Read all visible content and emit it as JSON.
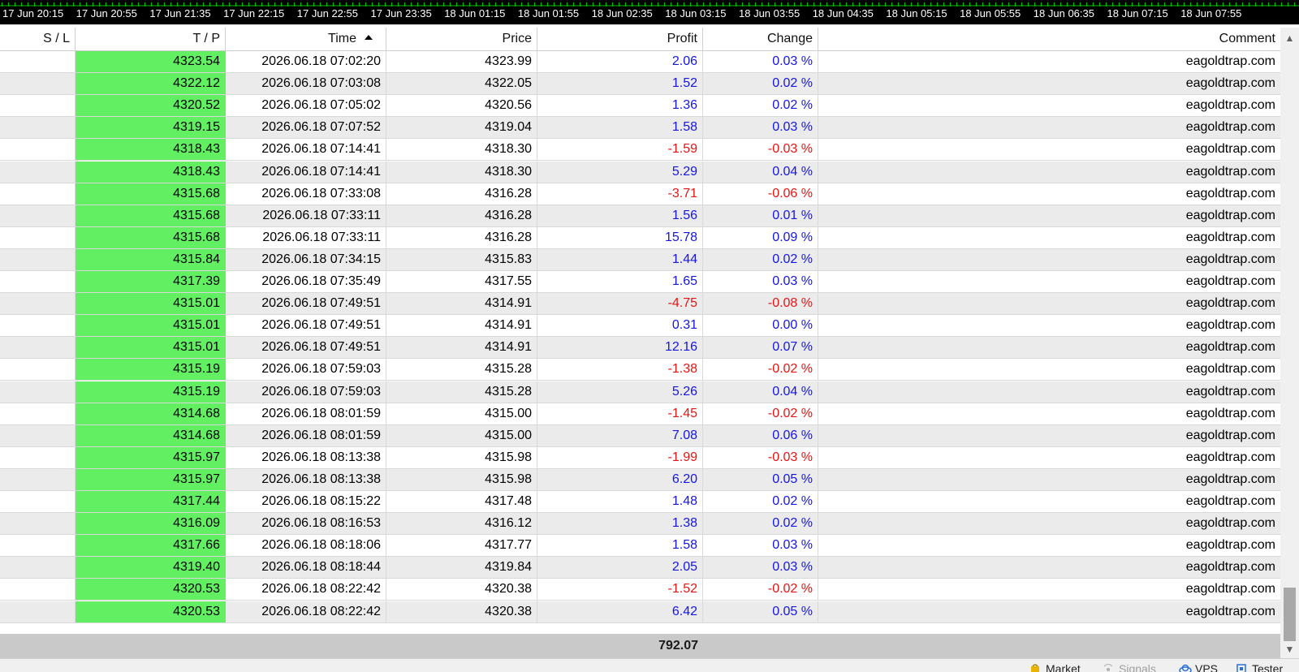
{
  "time_axis": {
    "labels": [
      "17 Jun 20:15",
      "17 Jun 20:55",
      "17 Jun 21:35",
      "17 Jun 22:15",
      "17 Jun 22:55",
      "17 Jun 23:35",
      "18 Jun 01:15",
      "18 Jun 01:55",
      "18 Jun 02:35",
      "18 Jun 03:15",
      "18 Jun 03:55",
      "18 Jun 04:35",
      "18 Jun 05:15",
      "18 Jun 05:55",
      "18 Jun 06:35",
      "18 Jun 07:15",
      "18 Jun 07:55"
    ],
    "tick_color": "#00c000"
  },
  "table": {
    "columns": [
      "S / L",
      "T / P",
      "Time",
      "Price",
      "Profit",
      "Change",
      "Comment"
    ],
    "sorted_column": "Time",
    "sort_direction": "ascending",
    "rows": [
      {
        "sl": "",
        "tp": "4323.54",
        "time": "2026.06.18 07:02:20",
        "price": "4323.99",
        "profit": "2.06",
        "change": "0.03 %",
        "comment": "eagoldtrap.com"
      },
      {
        "sl": "",
        "tp": "4322.12",
        "time": "2026.06.18 07:03:08",
        "price": "4322.05",
        "profit": "1.52",
        "change": "0.02 %",
        "comment": "eagoldtrap.com"
      },
      {
        "sl": "",
        "tp": "4320.52",
        "time": "2026.06.18 07:05:02",
        "price": "4320.56",
        "profit": "1.36",
        "change": "0.02 %",
        "comment": "eagoldtrap.com"
      },
      {
        "sl": "",
        "tp": "4319.15",
        "time": "2026.06.18 07:07:52",
        "price": "4319.04",
        "profit": "1.58",
        "change": "0.03 %",
        "comment": "eagoldtrap.com"
      },
      {
        "sl": "",
        "tp": "4318.43",
        "time": "2026.06.18 07:14:41",
        "price": "4318.30",
        "profit": "-1.59",
        "change": "-0.03 %",
        "comment": "eagoldtrap.com"
      },
      {
        "sl": "",
        "tp": "4318.43",
        "time": "2026.06.18 07:14:41",
        "price": "4318.30",
        "profit": "5.29",
        "change": "0.04 %",
        "comment": "eagoldtrap.com"
      },
      {
        "sl": "",
        "tp": "4315.68",
        "time": "2026.06.18 07:33:08",
        "price": "4316.28",
        "profit": "-3.71",
        "change": "-0.06 %",
        "comment": "eagoldtrap.com"
      },
      {
        "sl": "",
        "tp": "4315.68",
        "time": "2026.06.18 07:33:11",
        "price": "4316.28",
        "profit": "1.56",
        "change": "0.01 %",
        "comment": "eagoldtrap.com"
      },
      {
        "sl": "",
        "tp": "4315.68",
        "time": "2026.06.18 07:33:11",
        "price": "4316.28",
        "profit": "15.78",
        "change": "0.09 %",
        "comment": "eagoldtrap.com"
      },
      {
        "sl": "",
        "tp": "4315.84",
        "time": "2026.06.18 07:34:15",
        "price": "4315.83",
        "profit": "1.44",
        "change": "0.02 %",
        "comment": "eagoldtrap.com"
      },
      {
        "sl": "",
        "tp": "4317.39",
        "time": "2026.06.18 07:35:49",
        "price": "4317.55",
        "profit": "1.65",
        "change": "0.03 %",
        "comment": "eagoldtrap.com"
      },
      {
        "sl": "",
        "tp": "4315.01",
        "time": "2026.06.18 07:49:51",
        "price": "4314.91",
        "profit": "-4.75",
        "change": "-0.08 %",
        "comment": "eagoldtrap.com"
      },
      {
        "sl": "",
        "tp": "4315.01",
        "time": "2026.06.18 07:49:51",
        "price": "4314.91",
        "profit": "0.31",
        "change": "0.00 %",
        "comment": "eagoldtrap.com"
      },
      {
        "sl": "",
        "tp": "4315.01",
        "time": "2026.06.18 07:49:51",
        "price": "4314.91",
        "profit": "12.16",
        "change": "0.07 %",
        "comment": "eagoldtrap.com"
      },
      {
        "sl": "",
        "tp": "4315.19",
        "time": "2026.06.18 07:59:03",
        "price": "4315.28",
        "profit": "-1.38",
        "change": "-0.02 %",
        "comment": "eagoldtrap.com"
      },
      {
        "sl": "",
        "tp": "4315.19",
        "time": "2026.06.18 07:59:03",
        "price": "4315.28",
        "profit": "5.26",
        "change": "0.04 %",
        "comment": "eagoldtrap.com"
      },
      {
        "sl": "",
        "tp": "4314.68",
        "time": "2026.06.18 08:01:59",
        "price": "4315.00",
        "profit": "-1.45",
        "change": "-0.02 %",
        "comment": "eagoldtrap.com"
      },
      {
        "sl": "",
        "tp": "4314.68",
        "time": "2026.06.18 08:01:59",
        "price": "4315.00",
        "profit": "7.08",
        "change": "0.06 %",
        "comment": "eagoldtrap.com"
      },
      {
        "sl": "",
        "tp": "4315.97",
        "time": "2026.06.18 08:13:38",
        "price": "4315.98",
        "profit": "-1.99",
        "change": "-0.03 %",
        "comment": "eagoldtrap.com"
      },
      {
        "sl": "",
        "tp": "4315.97",
        "time": "2026.06.18 08:13:38",
        "price": "4315.98",
        "profit": "6.20",
        "change": "0.05 %",
        "comment": "eagoldtrap.com"
      },
      {
        "sl": "",
        "tp": "4317.44",
        "time": "2026.06.18 08:15:22",
        "price": "4317.48",
        "profit": "1.48",
        "change": "0.02 %",
        "comment": "eagoldtrap.com"
      },
      {
        "sl": "",
        "tp": "4316.09",
        "time": "2026.06.18 08:16:53",
        "price": "4316.12",
        "profit": "1.38",
        "change": "0.02 %",
        "comment": "eagoldtrap.com"
      },
      {
        "sl": "",
        "tp": "4317.66",
        "time": "2026.06.18 08:18:06",
        "price": "4317.77",
        "profit": "1.58",
        "change": "0.03 %",
        "comment": "eagoldtrap.com"
      },
      {
        "sl": "",
        "tp": "4319.40",
        "time": "2026.06.18 08:18:44",
        "price": "4319.84",
        "profit": "2.05",
        "change": "0.03 %",
        "comment": "eagoldtrap.com"
      },
      {
        "sl": "",
        "tp": "4320.53",
        "time": "2026.06.18 08:22:42",
        "price": "4320.38",
        "profit": "-1.52",
        "change": "-0.02 %",
        "comment": "eagoldtrap.com"
      },
      {
        "sl": "",
        "tp": "4320.53",
        "time": "2026.06.18 08:22:42",
        "price": "4320.38",
        "profit": "6.42",
        "change": "0.05 %",
        "comment": "eagoldtrap.com"
      }
    ],
    "total_profit": "792.07",
    "colors": {
      "tp_fill": "#62ef62",
      "positive": "#1515e6",
      "negative": "#e81414",
      "row_alt": "#ebebeb",
      "total_bg": "#c9c9c9"
    }
  },
  "bottom_tabs": [
    {
      "label": "Market",
      "icon": "market-bag-icon",
      "enabled": true
    },
    {
      "label": "Signals",
      "icon": "signals-icon",
      "enabled": false
    },
    {
      "label": "VPS",
      "icon": "vps-cloud-icon",
      "enabled": true
    },
    {
      "label": "Tester",
      "icon": "tester-chip-icon",
      "enabled": true
    }
  ]
}
